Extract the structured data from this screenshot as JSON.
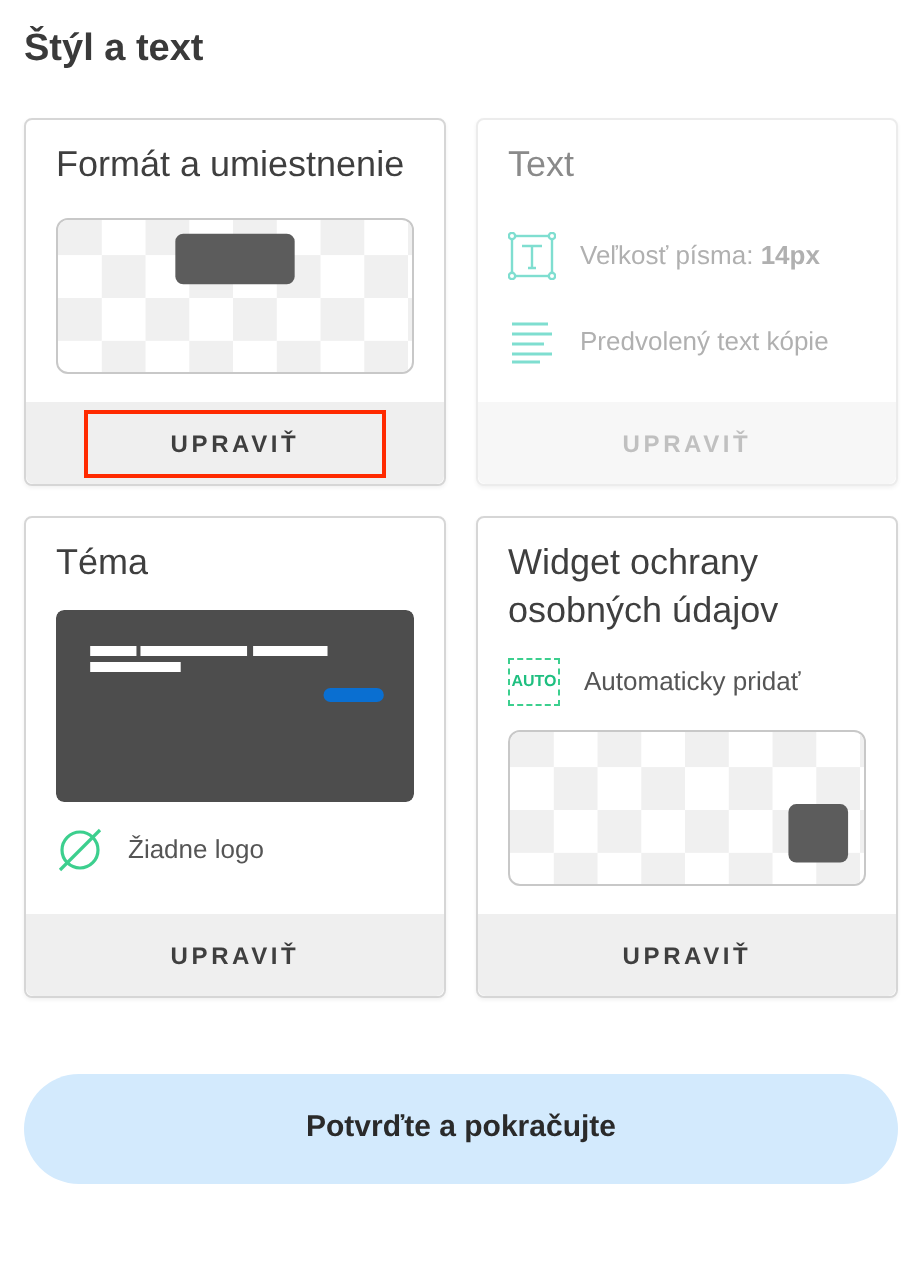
{
  "title": "Štýl a text",
  "cards": [
    {
      "kind": "format",
      "title": "Formát a umiestnenie",
      "disabled": false,
      "button": {
        "label": "UPRAVIŤ",
        "highlighted": true
      }
    },
    {
      "kind": "text",
      "title": "Text",
      "disabled": true,
      "items": [
        {
          "kind": "font-size",
          "text": "Veľkosť písma: **14px**"
        },
        {
          "kind": "copy",
          "text": "Predvolený text kópie"
        }
      ],
      "button": {
        "label": "UPRAVIŤ",
        "highlighted": false
      }
    },
    {
      "kind": "theme",
      "title": "Téma",
      "disabled": false,
      "items": [
        {
          "kind": "no-logo",
          "text": "Žiadne logo"
        }
      ],
      "button": {
        "label": "UPRAVIŤ",
        "highlighted": false
      }
    },
    {
      "kind": "widget",
      "title": "Widget ochrany osobných údajov",
      "disabled": false,
      "items": [
        {
          "kind": "auto",
          "icon_text": "AUTO",
          "text": "Automaticky pridať"
        }
      ],
      "button": {
        "label": "UPRAVIŤ",
        "highlighted": false
      }
    }
  ],
  "confirm_button": "Potvrďte a pokračujte"
}
